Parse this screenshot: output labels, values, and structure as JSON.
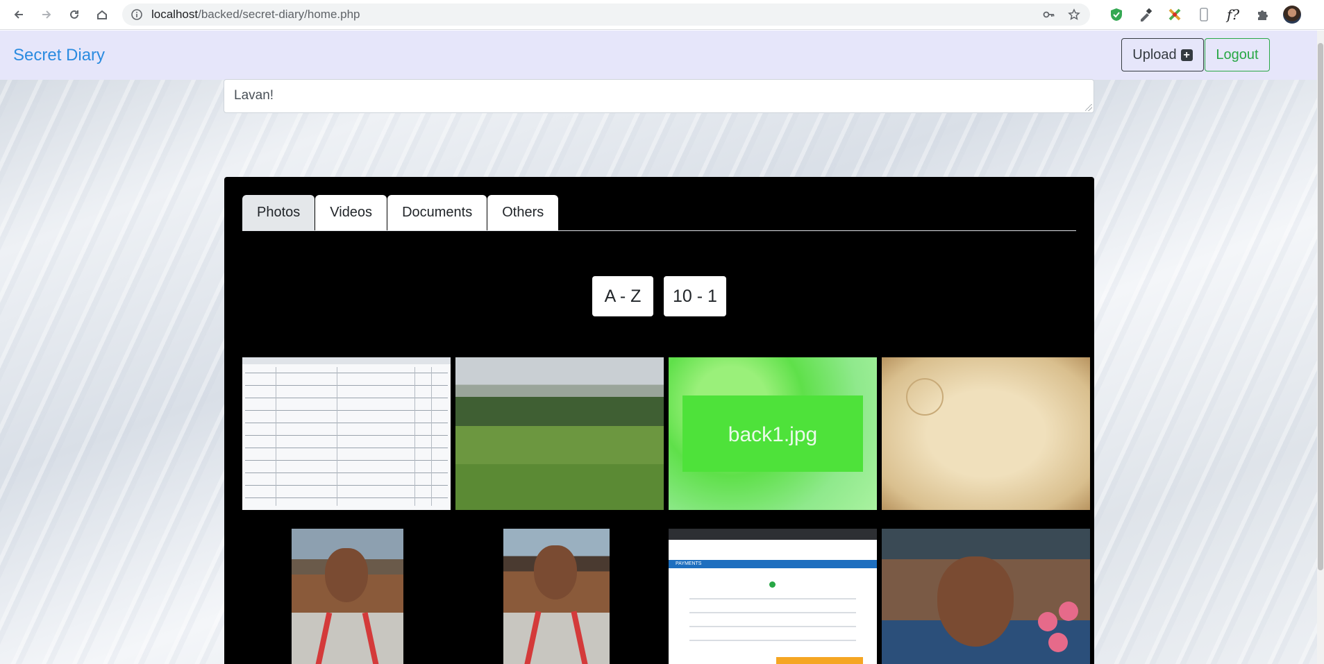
{
  "browser": {
    "url_host": "localhost",
    "url_path": "/backed/secret-diary/home.php"
  },
  "navbar": {
    "brand": "Secret Diary",
    "upload_label": "Upload",
    "logout_label": "Logout"
  },
  "diary": {
    "text": "Lavan!"
  },
  "tabs": [
    {
      "label": "Photos",
      "active": true
    },
    {
      "label": "Videos",
      "active": false
    },
    {
      "label": "Documents",
      "active": false
    },
    {
      "label": "Others",
      "active": false
    }
  ],
  "sort": {
    "alpha_label": "A - Z",
    "num_label": "10 - 1"
  },
  "photos": {
    "green_label": "back1.jpg",
    "payment_title": "PAYMENTS"
  },
  "extensions": {
    "f_label": "f?"
  }
}
